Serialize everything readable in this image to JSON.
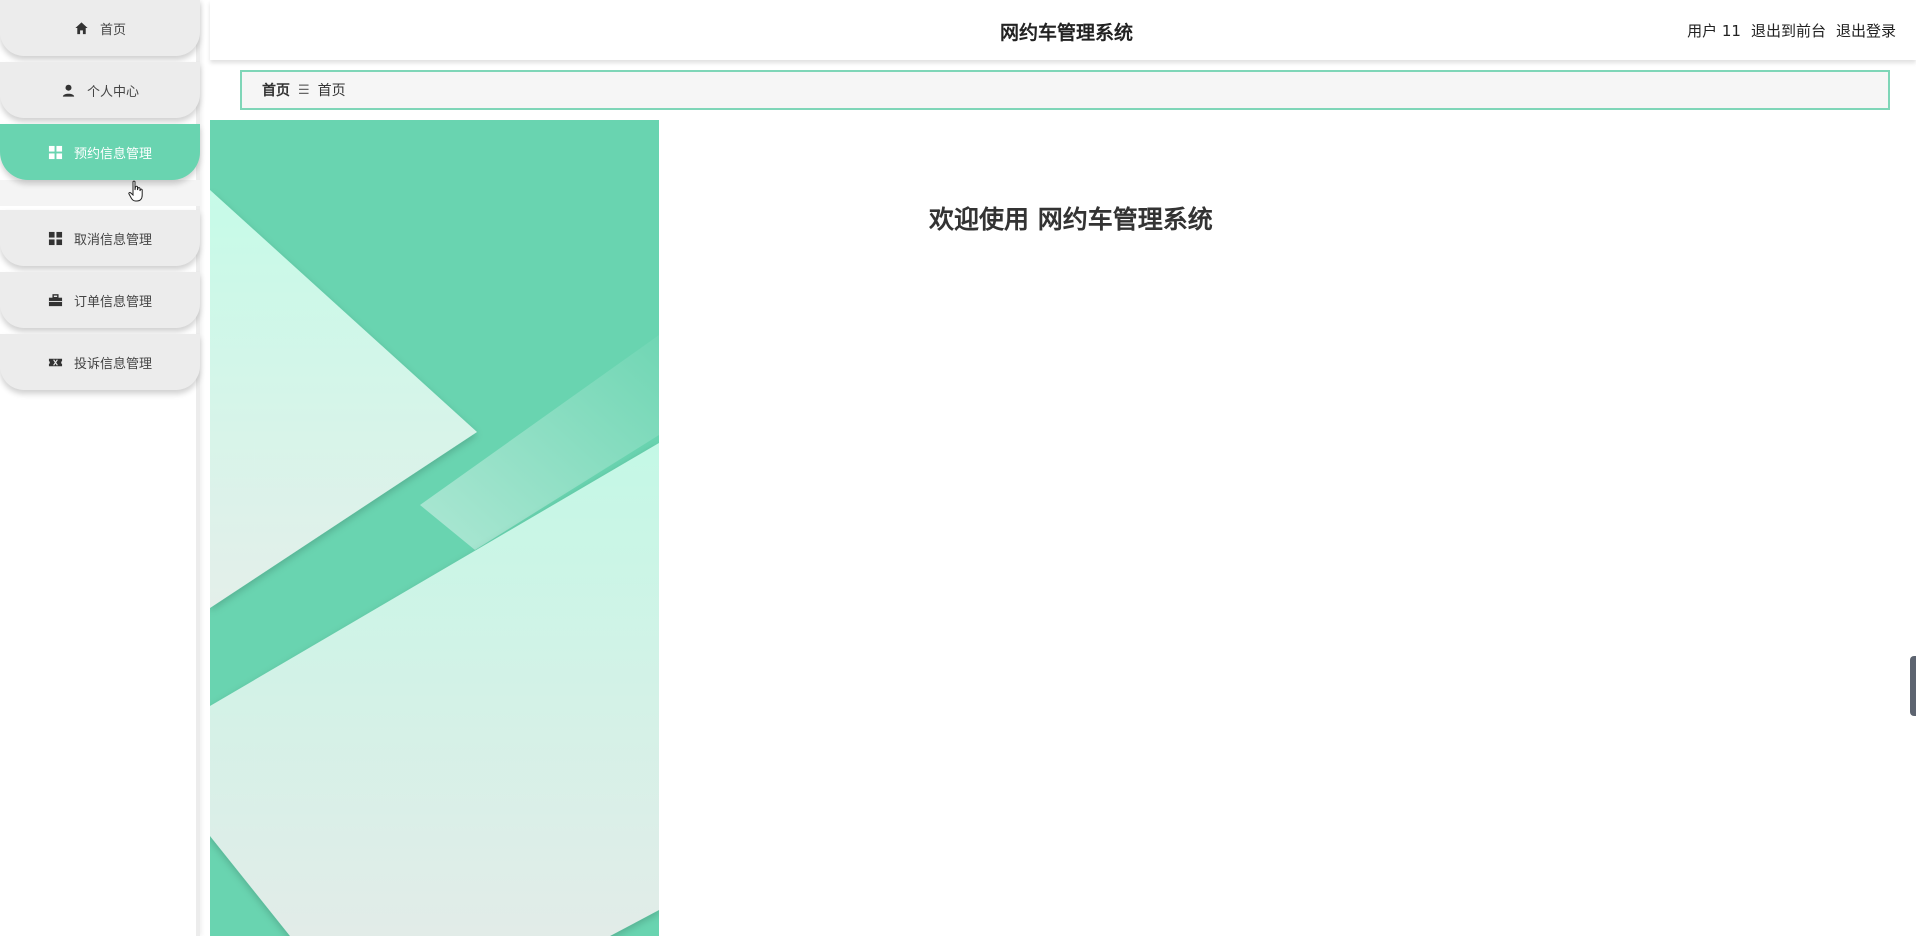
{
  "app": {
    "title": "网约车管理系统",
    "welcome": "欢迎使用 网约车管理系统"
  },
  "header": {
    "user": "用户 11",
    "to_front": "退出到前台",
    "logout": "退出登录"
  },
  "breadcrumb": {
    "home": "首页",
    "separator": "☰",
    "current": "首页"
  },
  "sidebar": {
    "items": [
      {
        "label": "首页",
        "icon": "home-icon"
      },
      {
        "label": "个人中心",
        "icon": "user-icon"
      },
      {
        "label": "预约信息管理",
        "icon": "grid-icon",
        "active": true
      },
      {
        "label": "取消信息管理",
        "icon": "grid-icon"
      },
      {
        "label": "订单信息管理",
        "icon": "briefcase-icon"
      },
      {
        "label": "投诉信息管理",
        "icon": "ticket-icon"
      }
    ]
  },
  "colors": {
    "accent": "#69d4b0",
    "menu_bg": "#ececec",
    "breadcrumb_border": "#7fd6b8"
  }
}
